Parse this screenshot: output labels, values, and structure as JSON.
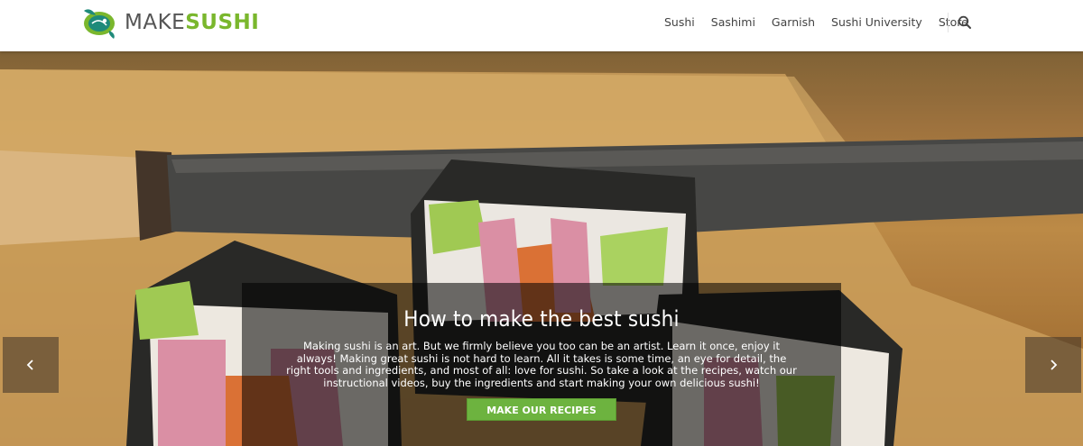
{
  "brand": {
    "make": "MAKE",
    "sushi": "SUSHI"
  },
  "nav": {
    "items": [
      {
        "label": "Sushi"
      },
      {
        "label": "Sashimi"
      },
      {
        "label": "Garnish"
      },
      {
        "label": "Sushi University"
      },
      {
        "label": "Store"
      }
    ],
    "search_icon": "search-icon"
  },
  "hero": {
    "title": "How to make the best sushi",
    "text": "Making sushi is an art. But we firmly believe you too can be an artist. Learn it once, enjoy it always! Making great sushi is not hard to learn. All it takes is some time, an eye for detail, the right tools and ingredients, and most of all: love for sushi. So take a look at the recipes, watch our instructional videos, buy the ingredients and start making your own delicious sushi!",
    "cta_label": "MAKE OUR RECIPES",
    "prev_icon": "chevron-left-icon",
    "next_icon": "chevron-right-icon"
  },
  "colors": {
    "brand_green": "#7ab72d",
    "button_green": "#6db33f",
    "nav_text": "#444444"
  }
}
